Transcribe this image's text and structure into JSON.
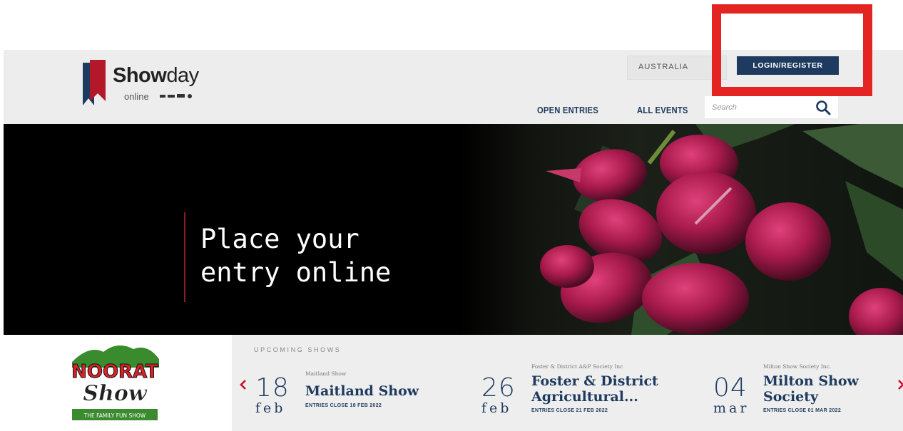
{
  "caption": "",
  "header": {
    "logo": {
      "word_bold": "Show",
      "word_light": "day",
      "sub": "online"
    },
    "country": {
      "selected": "AUSTRALIA"
    },
    "login_label": "LOGIN/REGISTER",
    "nav": [
      {
        "label": "OPEN ENTRIES"
      },
      {
        "label": "ALL EVENTS"
      }
    ],
    "search": {
      "placeholder": "Search"
    }
  },
  "hero": {
    "line1": "Place your",
    "line2": "entry online"
  },
  "featured_logo": {
    "title": "NOORAT",
    "script": "Show",
    "tagline": "THE FAMILY FUN SHOW"
  },
  "upcoming": {
    "label": "UPCOMING SHOWS",
    "shows": [
      {
        "day": "18",
        "month": "feb",
        "society": "Maitland Show",
        "name_line1": "Maitland Show",
        "name_line2": "",
        "closes": "ENTRIES CLOSE 18 FEB 2022"
      },
      {
        "day": "26",
        "month": "feb",
        "society": "Foster & District A&P Society Inc",
        "name_line1": "Foster & District",
        "name_line2": "Agricultural...",
        "closes": "ENTRIES CLOSE 21 FEB 2022"
      },
      {
        "day": "04",
        "month": "mar",
        "society": "Milton Show Society Inc.",
        "name_line1": "Milton Show",
        "name_line2": "Society",
        "closes": "ENTRIES CLOSE 01 MAR 2022"
      }
    ]
  },
  "colors": {
    "navy": "#1e3a5f",
    "highlight_red": "#e32423",
    "header_bg": "#ededed",
    "strip_bg": "#eeeeee",
    "arrow_red": "#c8102e"
  }
}
